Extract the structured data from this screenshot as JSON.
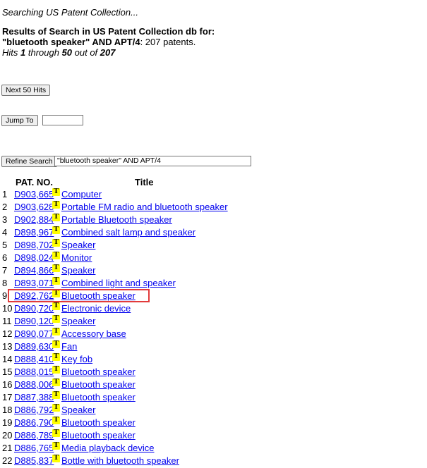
{
  "status_text": "Searching US Patent Collection...",
  "results_header": {
    "line1": "Results of Search in US Patent Collection db for:",
    "query": "\"bluetooth speaker\" AND APT/4",
    "count_text": ": 207 patents."
  },
  "hits": {
    "prefix": "Hits ",
    "from": "1",
    "through_text": " through ",
    "to": "50",
    "outof_text": " out of ",
    "total": "207"
  },
  "buttons": {
    "next_hits": "Next 50 Hits",
    "jump_to": "Jump To",
    "refine_search": "Refine Search"
  },
  "refine_input_value": "\"bluetooth speaker\" AND APT/4",
  "jump_input_value": "",
  "table": {
    "col_patno": "PAT. NO.",
    "col_title": "Title",
    "icon_letter": "T",
    "rows": [
      {
        "n": "1",
        "pat": "D903,665",
        "title": "Computer"
      },
      {
        "n": "2",
        "pat": "D903,628",
        "title": "Portable FM radio and bluetooth speaker"
      },
      {
        "n": "3",
        "pat": "D902,884",
        "title": "Portable Bluetooth speaker"
      },
      {
        "n": "4",
        "pat": "D898,967",
        "title": "Combined salt lamp and speaker"
      },
      {
        "n": "5",
        "pat": "D898,702",
        "title": "Speaker"
      },
      {
        "n": "6",
        "pat": "D898,024",
        "title": "Monitor"
      },
      {
        "n": "7",
        "pat": "D894,866",
        "title": "Speaker"
      },
      {
        "n": "8",
        "pat": "D893,071",
        "title": "Combined light and speaker"
      },
      {
        "n": "9",
        "pat": "D892,762",
        "title": "Bluetooth speaker"
      },
      {
        "n": "10",
        "pat": "D890,720",
        "title": "Electronic device"
      },
      {
        "n": "11",
        "pat": "D890,120",
        "title": "Speaker"
      },
      {
        "n": "12",
        "pat": "D890,077",
        "title": "Accessory base"
      },
      {
        "n": "13",
        "pat": "D889,630",
        "title": "Fan"
      },
      {
        "n": "14",
        "pat": "D888,410",
        "title": "Key fob"
      },
      {
        "n": "15",
        "pat": "D888,015",
        "title": "Bluetooth speaker"
      },
      {
        "n": "16",
        "pat": "D888,006",
        "title": "Bluetooth speaker"
      },
      {
        "n": "17",
        "pat": "D887,388",
        "title": "Bluetooth speaker"
      },
      {
        "n": "18",
        "pat": "D886,792",
        "title": "Speaker"
      },
      {
        "n": "19",
        "pat": "D886,790",
        "title": "Bluetooth speaker"
      },
      {
        "n": "20",
        "pat": "D886,789",
        "title": "Bluetooth speaker"
      },
      {
        "n": "21",
        "pat": "D886,765",
        "title": "Media playback device"
      },
      {
        "n": "22",
        "pat": "D885,837",
        "title": "Bottle with bluetooth speaker"
      }
    ]
  },
  "colors": {
    "link": "#0000ee",
    "icon_bg": "#ffff00",
    "highlight": "#e23b3b"
  }
}
